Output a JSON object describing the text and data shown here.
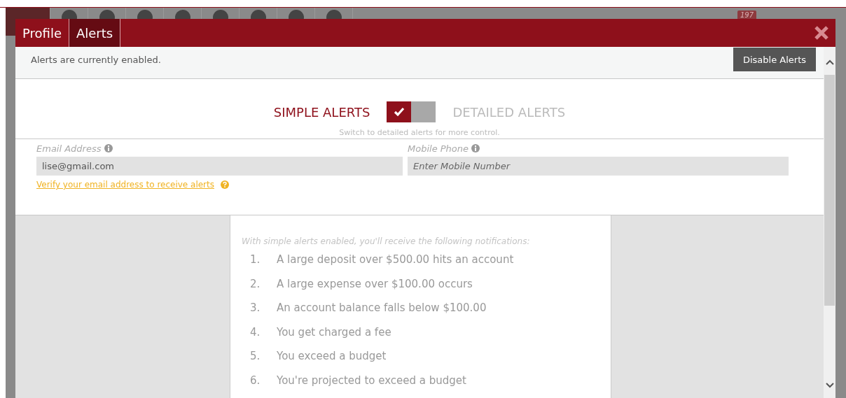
{
  "background": {
    "badge": "197"
  },
  "tabs": [
    {
      "label": "Profile",
      "selected": false
    },
    {
      "label": "Alerts",
      "selected": true
    }
  ],
  "status": {
    "text": "Alerts are currently enabled.",
    "button": "Disable Alerts"
  },
  "modes": [
    {
      "label": "SIMPLE ALERTS",
      "selected": true
    },
    {
      "label": "DETAILED ALERTS",
      "selected": false
    }
  ],
  "mode_hint": "Switch to detailed alerts for more control.",
  "fields": [
    {
      "label": "Email Address",
      "value": "lise@gmail.com"
    },
    {
      "label": "Mobile Phone",
      "placeholder": "Enter Mobile Number"
    }
  ],
  "verify_link": "Verify your email address to receive alerts",
  "notifications": {
    "intro": "With simple alerts enabled, you'll receive the following notifications:",
    "items": [
      {
        "number": "1.",
        "text": "A large deposit over $500.00 hits an account"
      },
      {
        "number": "2.",
        "text": "A large expense over $100.00 occurs"
      },
      {
        "number": "3.",
        "text": "An account balance falls below $100.00"
      },
      {
        "number": "4.",
        "text": "You get charged a fee"
      },
      {
        "number": "5.",
        "text": "You exceed a budget"
      },
      {
        "number": "6.",
        "text": "You're projected to exceed a budget"
      }
    ]
  }
}
